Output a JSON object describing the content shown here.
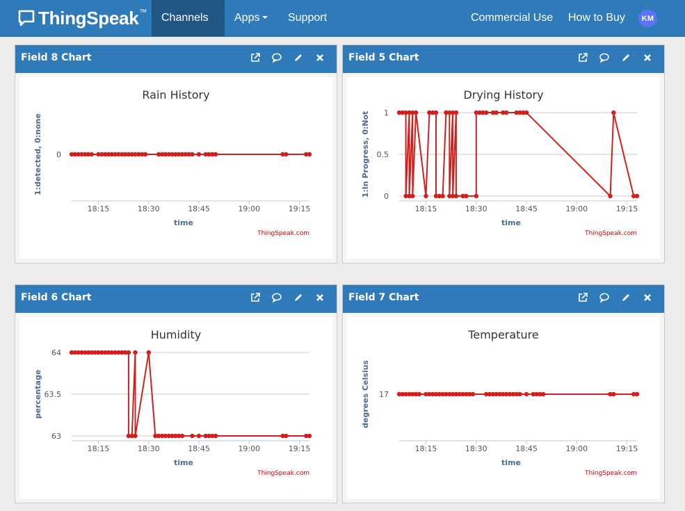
{
  "brand": {
    "name": "ThingSpeak",
    "tm": "™"
  },
  "nav": {
    "items": [
      {
        "label": "Channels",
        "dropdown": true,
        "active": true
      },
      {
        "label": "Apps",
        "dropdown": true,
        "active": false
      },
      {
        "label": "Support",
        "dropdown": true,
        "active": false
      }
    ],
    "right": [
      "Commercial Use",
      "How to Buy"
    ],
    "avatar": "KM"
  },
  "colors": {
    "nav": "#2f7ab8",
    "nav_active": "#1f5684",
    "series": "#d0201e",
    "avatar": "#5b73f7"
  },
  "panels": [
    {
      "title": "Field 8 Chart",
      "icons": [
        "external-link-icon",
        "comment-icon",
        "pencil-icon",
        "close-icon"
      ]
    },
    {
      "title": "Field 5 Chart",
      "icons": [
        "external-link-icon",
        "comment-icon",
        "pencil-icon",
        "close-icon"
      ]
    },
    {
      "title": "Field 6 Chart",
      "icons": [
        "external-link-icon",
        "comment-icon",
        "pencil-icon",
        "close-icon"
      ]
    },
    {
      "title": "Field 7 Chart",
      "icons": [
        "external-link-icon",
        "comment-icon",
        "pencil-icon",
        "close-icon"
      ]
    }
  ],
  "chart_data": [
    {
      "type": "line",
      "title": "Rain History",
      "ylabel": "1:detected, 0:none",
      "xlabel": "time",
      "credit": "ThingSpeak.com",
      "xlim": [
        "18:07",
        "19:18"
      ],
      "xticks": [
        "18:15",
        "18:30",
        "18:45",
        "19:00",
        "19:15"
      ],
      "yticks": [
        0
      ],
      "grid": "horizontal",
      "series": [
        {
          "x": [
            "18:07",
            "18:08",
            "18:09",
            "18:10",
            "18:11",
            "18:12",
            "18:13",
            "18:15",
            "18:16",
            "18:17",
            "18:18",
            "18:19",
            "18:20",
            "18:21",
            "18:22",
            "18:23",
            "18:24",
            "18:25",
            "18:26",
            "18:27",
            "18:28",
            "18:29",
            "18:33",
            "18:34",
            "18:35",
            "18:36",
            "18:37",
            "18:38",
            "18:39",
            "18:40",
            "18:41",
            "18:42",
            "18:43",
            "18:45",
            "18:47",
            "18:48",
            "18:49",
            "18:50",
            "19:10",
            "19:11",
            "19:17",
            "19:18"
          ],
          "y": [
            0,
            0,
            0,
            0,
            0,
            0,
            0,
            0,
            0,
            0,
            0,
            0,
            0,
            0,
            0,
            0,
            0,
            0,
            0,
            0,
            0,
            0,
            0,
            0,
            0,
            0,
            0,
            0,
            0,
            0,
            0,
            0,
            0,
            0,
            0,
            0,
            0,
            0,
            0,
            0,
            0,
            0
          ]
        }
      ]
    },
    {
      "type": "line",
      "title": "Drying History",
      "ylabel": "1:In Progress, 0:Not",
      "xlabel": "time",
      "credit": "ThingSpeak.com",
      "xlim": [
        "18:07",
        "19:18"
      ],
      "ylim": [
        0,
        1
      ],
      "xticks": [
        "18:15",
        "18:30",
        "18:45",
        "19:00",
        "19:15"
      ],
      "yticks": [
        0,
        0.5,
        1
      ],
      "grid": "horizontal",
      "series": [
        {
          "x": [
            "18:07",
            "18:08",
            "18:09",
            "18:09",
            "18:10",
            "18:10",
            "18:11",
            "18:11",
            "18:12",
            "18:15",
            "18:16",
            "18:16",
            "18:17",
            "18:18",
            "18:18",
            "18:19",
            "18:20",
            "18:21",
            "18:21",
            "18:22",
            "18:22",
            "18:23",
            "18:23",
            "18:24",
            "18:24",
            "18:26",
            "18:27",
            "18:30",
            "18:30",
            "18:31",
            "18:32",
            "18:33",
            "18:35",
            "18:36",
            "18:38",
            "18:39",
            "18:42",
            "18:43",
            "18:44",
            "18:45",
            "19:10",
            "19:11",
            "19:17",
            "19:18"
          ],
          "y": [
            1,
            1,
            1,
            0,
            1,
            0,
            1,
            0,
            1,
            0,
            1,
            1,
            1,
            1,
            0,
            0,
            0,
            1,
            1,
            1,
            0,
            1,
            0,
            1,
            0,
            0,
            0,
            0,
            1,
            1,
            1,
            1,
            1,
            1,
            1,
            1,
            1,
            1,
            1,
            1,
            0,
            1,
            0,
            0
          ]
        }
      ]
    },
    {
      "type": "line",
      "title": "Humidity",
      "ylabel": "percentage",
      "xlabel": "time",
      "credit": "ThingSpeak.com",
      "xlim": [
        "18:07",
        "19:18"
      ],
      "ylim": [
        63,
        64
      ],
      "xticks": [
        "18:15",
        "18:30",
        "18:45",
        "19:00",
        "19:15"
      ],
      "yticks": [
        63,
        63.5,
        64
      ],
      "grid": "horizontal",
      "series": [
        {
          "x": [
            "18:07",
            "18:08",
            "18:09",
            "18:10",
            "18:11",
            "18:12",
            "18:13",
            "18:14",
            "18:15",
            "18:16",
            "18:17",
            "18:18",
            "18:19",
            "18:20",
            "18:21",
            "18:22",
            "18:23",
            "18:24",
            "18:24",
            "18:25",
            "18:26",
            "18:26",
            "18:30",
            "18:32",
            "18:33",
            "18:34",
            "18:35",
            "18:36",
            "18:37",
            "18:38",
            "18:39",
            "18:40",
            "18:43",
            "18:45",
            "18:47",
            "18:48",
            "18:49",
            "18:50",
            "19:10",
            "19:11",
            "19:17",
            "19:18"
          ],
          "y": [
            64,
            64,
            64,
            64,
            64,
            64,
            64,
            64,
            64,
            64,
            64,
            64,
            64,
            64,
            64,
            64,
            64,
            64,
            63,
            63,
            64,
            63,
            64,
            63,
            63,
            63,
            63,
            63,
            63,
            63,
            63,
            63,
            63,
            63,
            63,
            63,
            63,
            63,
            63,
            63,
            63,
            63
          ]
        }
      ]
    },
    {
      "type": "line",
      "title": "Temperature",
      "ylabel": "degrees Celsius",
      "xlabel": "time",
      "credit": "ThingSpeak.com",
      "xlim": [
        "18:07",
        "19:18"
      ],
      "xticks": [
        "18:15",
        "18:30",
        "18:45",
        "19:00",
        "19:15"
      ],
      "yticks": [
        17
      ],
      "grid": "horizontal",
      "series": [
        {
          "x": [
            "18:07",
            "18:08",
            "18:09",
            "18:10",
            "18:11",
            "18:12",
            "18:13",
            "18:15",
            "18:16",
            "18:17",
            "18:18",
            "18:19",
            "18:20",
            "18:21",
            "18:22",
            "18:23",
            "18:24",
            "18:25",
            "18:26",
            "18:27",
            "18:28",
            "18:29",
            "18:33",
            "18:34",
            "18:35",
            "18:36",
            "18:37",
            "18:38",
            "18:39",
            "18:40",
            "18:41",
            "18:42",
            "18:43",
            "18:45",
            "18:47",
            "18:48",
            "18:49",
            "18:50",
            "19:10",
            "19:11",
            "19:17",
            "19:18"
          ],
          "y": [
            17,
            17,
            17,
            17,
            17,
            17,
            17,
            17,
            17,
            17,
            17,
            17,
            17,
            17,
            17,
            17,
            17,
            17,
            17,
            17,
            17,
            17,
            17,
            17,
            17,
            17,
            17,
            17,
            17,
            17,
            17,
            17,
            17,
            17,
            17,
            17,
            17,
            17,
            17,
            17,
            17,
            17
          ]
        }
      ]
    }
  ]
}
